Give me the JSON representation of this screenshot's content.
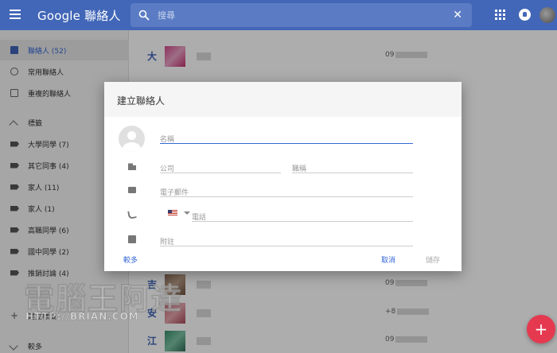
{
  "header": {
    "app_title": "Google 聯絡人",
    "search_placeholder": "搜尋",
    "search_clear": "✕",
    "brand_color": "#4267b8"
  },
  "sidebar": {
    "items": [
      {
        "label": "聯絡人 (52)",
        "icon": "contacts-icon",
        "active": true
      },
      {
        "label": "常用聯絡人",
        "icon": "history-icon"
      },
      {
        "label": "重複的聯絡人",
        "icon": "copy-icon"
      },
      {
        "label": "標籤",
        "icon": "chevron-up-icon"
      },
      {
        "label": "大學同學 (7)",
        "icon": "label-icon"
      },
      {
        "label": "其它同事 (4)",
        "icon": "label-icon"
      },
      {
        "label": "家人 (11)",
        "icon": "label-icon"
      },
      {
        "label": "家人 (1)",
        "icon": "label-icon"
      },
      {
        "label": "高職同學 (6)",
        "icon": "label-icon"
      },
      {
        "label": "國中同學 (2)",
        "icon": "label-icon"
      },
      {
        "label": "推銷討論 (4)",
        "icon": "label-icon"
      },
      {
        "label": "建立標籤",
        "icon": "plus-icon"
      },
      {
        "label": "較多",
        "icon": "chevron-down-icon"
      }
    ]
  },
  "contacts": {
    "rows": [
      {
        "letter": "大",
        "phone": "09"
      },
      {
        "letter": "吉",
        "phone": "09"
      },
      {
        "letter": "安",
        "phone": "+8"
      },
      {
        "letter": "江",
        "phone": "09"
      }
    ]
  },
  "dialog": {
    "title": "建立聯絡人",
    "name_placeholder": "名稱",
    "company_placeholder": "公司",
    "jobtitle_placeholder": "職稱",
    "email_placeholder": "電子郵件",
    "phone_placeholder": "電話",
    "notes_placeholder": "附註",
    "more_label": "較多",
    "cancel_label": "取消",
    "save_label": "儲存",
    "accent_color": "#3367d6"
  },
  "fab": {
    "label": "+",
    "color": "#e53950"
  },
  "watermark": {
    "main": "電腦王阿達",
    "sub": "HTTP://BRIAN.COM"
  }
}
